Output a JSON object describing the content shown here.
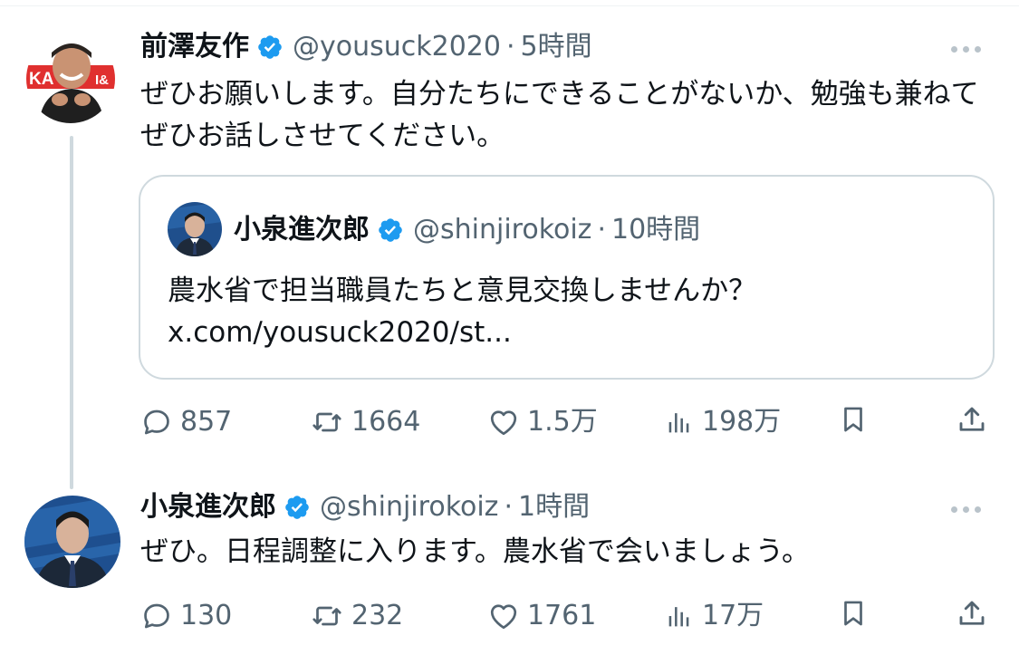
{
  "tweets": [
    {
      "author_name": "前澤友作",
      "handle": "@yousuck2020",
      "separator": "·",
      "time": "5時間",
      "text": "ぜひお願いします。自分たちにできることがないか、勉強も兼ねてぜひお話しさせてください。",
      "avatar_badge": "KA",
      "avatar_badge_right": "I&",
      "quoted": {
        "author_name": "小泉進次郎",
        "handle": "@shinjirokoiz",
        "separator": "·",
        "time": "10時間",
        "text": "農水省で担当職員たちと意見交換しませんか？ x.com/yousuck2020/st..."
      },
      "stats": {
        "replies": "857",
        "retweets": "1664",
        "likes": "1.5万",
        "views": "198万"
      }
    },
    {
      "author_name": "小泉進次郎",
      "handle": "@shinjirokoiz",
      "separator": "·",
      "time": "1時間",
      "text": "ぜひ。日程調整に入ります。農水省で会いましょう。",
      "stats": {
        "replies": "130",
        "retweets": "232",
        "likes": "1761",
        "views": "17万"
      }
    }
  ],
  "colors": {
    "text": "#0f1419",
    "secondary": "#536471",
    "verified": "#1d9bf0",
    "border": "#cfd9de",
    "thread_line": "#cfd9de"
  },
  "icons": {
    "reply": "speech-bubble-icon",
    "retweet": "retweet-arrows-icon",
    "like": "heart-icon",
    "views": "bar-chart-icon",
    "bookmark": "bookmark-icon",
    "share": "share-upload-icon",
    "more": "three-dots-icon",
    "verified": "verified-badge-icon"
  }
}
